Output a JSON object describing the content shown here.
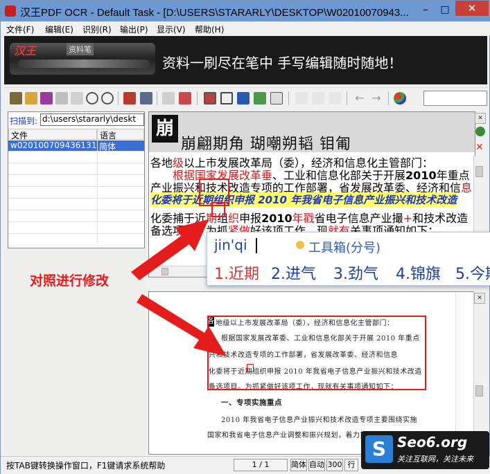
{
  "window": {
    "title": "汉王PDF OCR - Default Task - [D:\\USERS\\STARARLY\\DESKTOP\\W02010070943...",
    "controls": {
      "minimize": "–",
      "maximize": "□",
      "close": "✕"
    }
  },
  "menu": {
    "items": [
      {
        "label": "文件(F)"
      },
      {
        "label": "编辑(E)"
      },
      {
        "label": "识别(R)"
      },
      {
        "label": "输出(P)"
      },
      {
        "label": "显示(V)"
      },
      {
        "label": "帮助(H)"
      }
    ]
  },
  "banner": {
    "brand": "汉王",
    "product": "资料笔",
    "slogan": "资料一刷尽在笔中    手写编辑随时随地！"
  },
  "left_panel": {
    "scan_label": "扫描到:",
    "scan_path": "d:\\users\\stararly\\deskt",
    "columns": {
      "file": "文件",
      "lang": "语言"
    },
    "rows": [
      {
        "file": "w020100709436131...",
        "lang": "简体"
      }
    ]
  },
  "annotation": {
    "text": "对照进行修改"
  },
  "ocr_strip": {
    "glyph": "崩",
    "chars": "崩翩期角 瑚嘲朔韬 钼匍"
  },
  "ocr_text": {
    "line1_a": "各地",
    "line1_b": "级",
    "line1_c": "以上市发展改革局（委），经济和信息化主管部门：",
    "line2_a": "根据国家发展改革",
    "line2_b": "垂",
    "line2_c": "、工业和信息化部关于开展",
    "line2_d": "2010",
    "line2_e": "年重点",
    "line3_a": "产业振兴和技术改造专项的工作部署，省发展改革委、经济和信",
    "line3_b": "息",
    "line4": "化委将于近期组织申报 2010 年我省电子信息产业振兴和技术改造",
    "line5_a": "化委捕",
    "line5_b": "于",
    "line5_c": "近",
    "line5_d": "期",
    "line5_e": "组",
    "line5_f": "织",
    "line5_g": "申报",
    "line5_h": "2010",
    "line5_i": "年戳",
    "line5_j": "省电子信息产业撮",
    "line5_k": "+",
    "line5_l": "和技术改造",
    "line6_a": "备选项目。为抓",
    "line6_b": "紧做",
    "line6_c": "好该项工作，现",
    "line6_d": "就有",
    "line6_e": "关事项通知如下："
  },
  "ime": {
    "pinyin": "jin'qi",
    "toolbox": "工具箱(分号)",
    "candidates": [
      "1.近期",
      "2.进气",
      "3.劲气",
      "4.锦旗",
      "5.今期"
    ]
  },
  "doc": {
    "lines": [
      "地级以上市发展改革局（委），经济和信息化主管部门：",
      "根据国家发展改革委、工业和信息化部关于开展 2010 年重点",
      "兴和技术改造专项的工作部署，省发展改革委、经济和信息",
      "化委将于近期组织申报 2010 年我省电子信息产业振兴和技术改造",
      "备选项目。为抓紧做好该项工作，现就有关事项通知如下：",
      "一、专项实施重点",
      "2010 年我省电子信息产业振兴和技术改造专项主要围绕实施",
      "国家和我省电子信息产业调整和振兴规划，着力推进产业结构"
    ],
    "first_glyph": "各"
  },
  "status": {
    "message": "按TAB键转换操作窗口，F1键请求系统帮助",
    "page": "1 / 1",
    "lang": "简体",
    "mode": "自动",
    "dpi": "300",
    "cell5": "行"
  },
  "watermark": {
    "logo": "S",
    "domain": "Seo6.org",
    "tagline": "关注互联网，关注未来"
  },
  "colors": {
    "titlebar": "#6c98d4",
    "accent_red": "#e41c1c",
    "selection": "#3a6fd8"
  }
}
